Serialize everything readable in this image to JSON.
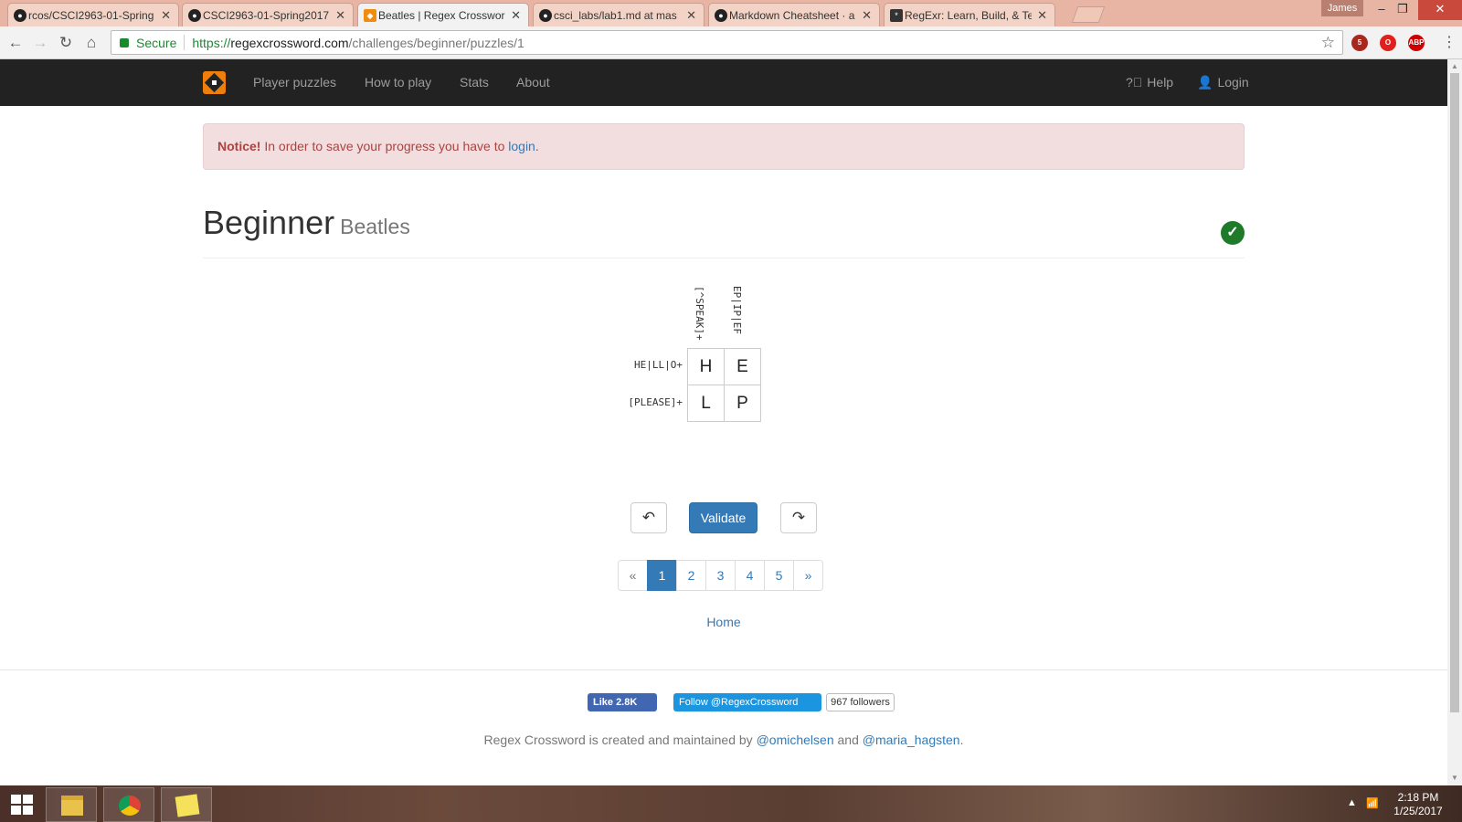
{
  "browser": {
    "tabs": [
      {
        "title": "rcos/CSCI2963-01-Spring",
        "favicon": "github-icon",
        "active": false
      },
      {
        "title": "CSCI2963-01-Spring2017",
        "favicon": "github-icon",
        "active": false
      },
      {
        "title": "Beatles | Regex Crosswor",
        "favicon": "regexcrossword-icon",
        "active": true
      },
      {
        "title": "csci_labs/lab1.md at mas",
        "favicon": "github-icon",
        "active": false
      },
      {
        "title": "Markdown Cheatsheet · a",
        "favicon": "github-icon",
        "active": false
      },
      {
        "title": "RegExr: Learn, Build, & Te",
        "favicon": "regexr-icon",
        "active": false
      }
    ],
    "close_glyph": "✕",
    "user": "James",
    "secure_label": "Secure",
    "url_proto": "https://",
    "url_host": "regexcrossword.com",
    "url_path": "/challenges/beginner/puzzles/1",
    "extension_badge": "5",
    "abp_label": "ABP"
  },
  "nav": {
    "links": [
      "Player puzzles",
      "How to play",
      "Stats",
      "About"
    ],
    "help": "Help",
    "login": "Login"
  },
  "alert": {
    "strong": "Notice!",
    "text": " In order to save your progress you have to ",
    "link": "login",
    "end": "."
  },
  "header": {
    "title": "Beginner",
    "subtitle": "Beatles",
    "status": "solved"
  },
  "puzzle": {
    "col_clues": [
      "[^SPEAK]+",
      "EP|IP|EF"
    ],
    "row_clues": [
      "HE|LL|O+",
      "[PLEASE]+"
    ],
    "grid": [
      [
        "H",
        "E"
      ],
      [
        "L",
        "P"
      ]
    ]
  },
  "controls": {
    "undo_glyph": "↶",
    "validate": "Validate",
    "redo_glyph": "↷"
  },
  "pagination": {
    "prev": "«",
    "pages": [
      "1",
      "2",
      "3",
      "4",
      "5"
    ],
    "active": "1",
    "next": "»"
  },
  "home_link": "Home",
  "footer": {
    "fb_like": "Like 2.8K",
    "tw_follow": "Follow @RegexCrossword",
    "tw_followers": "967 followers",
    "credit_prefix": "Regex Crossword is created and maintained by ",
    "author1": "@omichelsen",
    "credit_and": " and ",
    "author2": "@maria_hagsten",
    "credit_end": "."
  },
  "taskbar": {
    "time": "2:18 PM",
    "date": "1/25/2017"
  },
  "colors": {
    "navbar": "#222222",
    "brand": "#f07e0a",
    "primary": "#337ab7",
    "alert_bg": "#f2dede",
    "success": "#1f7a2a"
  }
}
